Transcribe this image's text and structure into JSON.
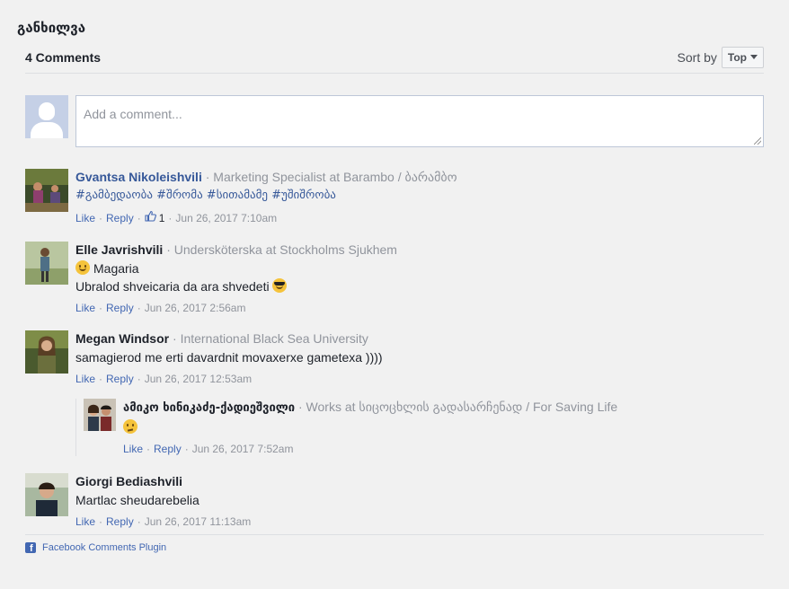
{
  "section_title": "განხილვა",
  "header": {
    "count_label": "4 Comments",
    "sort_label": "Sort by",
    "sort_value": "Top"
  },
  "composer": {
    "placeholder": "Add a comment..."
  },
  "comments": [
    {
      "author": "Gvantsa Nikoleishvili",
      "role": "Marketing Specialist at Barambo / ბარამბო",
      "text": "#გამბედაობა #შრომა #სითამამე #უშიშრობა",
      "like": "Like",
      "reply": "Reply",
      "likes_count": "1",
      "time": "Jun 26, 2017 7:10am"
    },
    {
      "author": "Elle Javrishvili",
      "role": "Undersköterska at Stockholms Sjukhem",
      "text_line1": "Magaria",
      "text_line2": "Ubralod shveicaria da ara shvedeti",
      "like": "Like",
      "reply": "Reply",
      "time": "Jun 26, 2017 2:56am"
    },
    {
      "author": "Megan Windsor",
      "role": "International Black Sea University",
      "text": "samagierod me erti davardnit movaxerxe gametexa ))))",
      "like": "Like",
      "reply": "Reply",
      "time": "Jun 26, 2017 12:53am",
      "reply_item": {
        "author": "ამიკო ხინიკაძე-ქადიეშვილი",
        "role": "Works at სიცოცხლის გადასარჩენად / For Saving Life",
        "like": "Like",
        "reply": "Reply",
        "time": "Jun 26, 2017 7:52am"
      }
    },
    {
      "author": "Giorgi Bediashvili",
      "text": "Martlac sheudarebelia",
      "like": "Like",
      "reply": "Reply",
      "time": "Jun 26, 2017 11:13am"
    }
  ],
  "footer": {
    "label": "Facebook Comments Plugin"
  },
  "colors": {
    "link": "#4267b2",
    "author_link": "#365899",
    "muted": "#90949c",
    "background": "#f1f1f1"
  }
}
